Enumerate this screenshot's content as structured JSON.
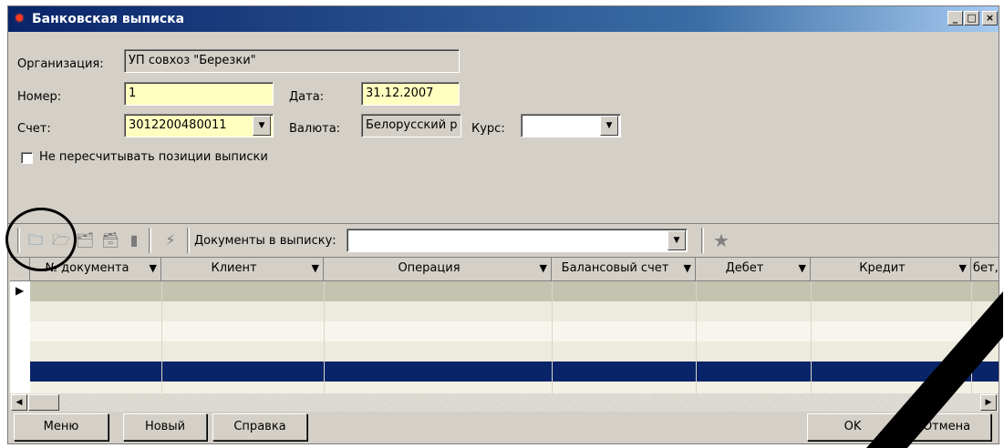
{
  "window": {
    "title": "Банковская выписка",
    "controls": {
      "minimize": "_",
      "maximize": "□",
      "close": "×"
    }
  },
  "form": {
    "organization": {
      "label": "Организация:",
      "value": "УП совхоз \"Березки\""
    },
    "number": {
      "label": "Номер:",
      "value": "1"
    },
    "date": {
      "label": "Дата:",
      "value": "31.12.2007"
    },
    "account": {
      "label": "Счет:",
      "value": "3012200480011"
    },
    "currency": {
      "label": "Валюта:",
      "value": "Белорусский р"
    },
    "rate": {
      "label": "Курс:",
      "value": ""
    },
    "no_recalc": {
      "label": "Не пересчитывать позиции выписки",
      "checked": false
    }
  },
  "toolbar": {
    "documents_label": "Документы в выписку:",
    "documents_value": ""
  },
  "grid": {
    "columns": [
      "№ документа",
      "Клиент",
      "Операция",
      "Балансовый счет",
      "Дебет",
      "Кредит",
      "бет, в"
    ],
    "selected_color": "#0a246a",
    "row_colors": [
      "#c4c3b0",
      "#ecebde",
      "#f7f6ee",
      "#ecebde",
      "#f7f6ee"
    ]
  },
  "buttons": {
    "menu": "Меню",
    "new": "Новый",
    "help": "Справка",
    "ok": "OK",
    "cancel": "Отмена"
  }
}
